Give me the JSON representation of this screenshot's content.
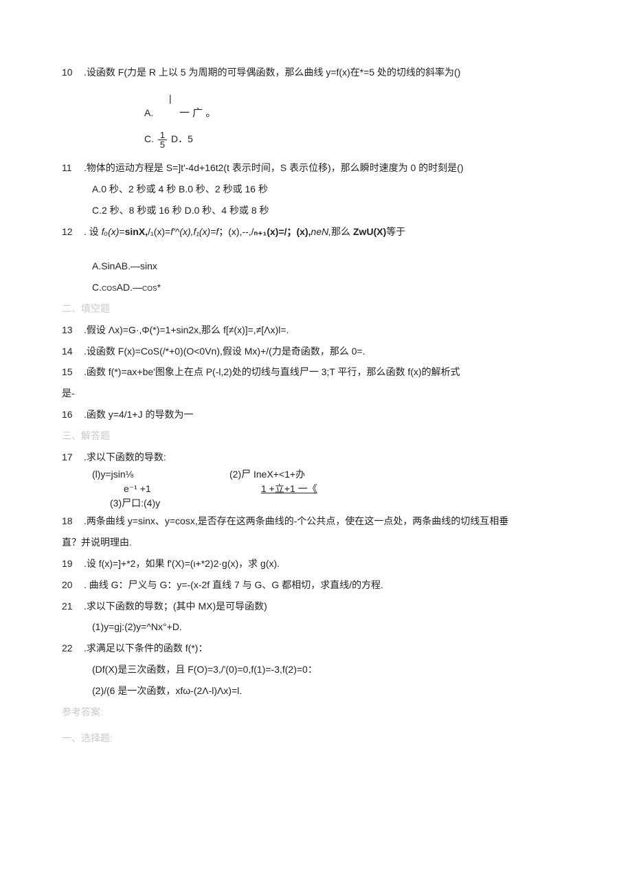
{
  "q10": {
    "num": "10",
    "text": " .设函数 F(力是 R 上以 5 为周期的可导偶函数，那么曲线 y=f(x)在*=5 处的切线的斜率为()",
    "optA_vertbar": "|",
    "optA_label": "A.",
    "optA_symbol": "一 广 。",
    "optC": "C.",
    "optC_frac_top": "1",
    "optC_frac_bot": "5",
    "optD": "D．5"
  },
  "q11": {
    "num": "11",
    "text": " .物体的运动方程是 S=]t'-4d+16t2(t 表示时间，S 表示位移)，那么瞬时速度为 0 的时刻是()",
    "optAB": "A.0 秒、2 秒或 4 秒 B.0 秒、2 秒或 16 秒",
    "optCD": "C.2 秒、8 秒或 16 秒 D.0 秒、4 秒或 8 秒"
  },
  "q12": {
    "num": "12",
    "prefix": " . 设 ",
    "expr_a": "fₒ(x)",
    "expr_eq1": "=",
    "expr_b": "sinX,",
    "expr_c": "/₁(x)",
    "expr_eq2": "=",
    "expr_d": "f'^(x),f₁(x)=f",
    "expr_e": "；(x),--,/",
    "expr_f": "ₙ₊₁",
    "expr_g": "(x)=/；(x),",
    "expr_h": "neN,",
    "expr_i": "那么 ",
    "expr_j": "Zᴡ",
    "expr_k": "U(X)",
    "expr_l": "等于",
    "optAB": "A.SinAB.—sinx",
    "optCD": "C.cosAD.—cos*"
  },
  "sec2": "二、填空题",
  "q13": {
    "num": "13",
    "text": " .假设 Λx)=G·,Φ(*)=1+sin2x,那么 f[≠(x)]=,≠[Λx)l=."
  },
  "q14": {
    "num": "14",
    "text": " .设函数 F(x)=CoS(/*+0)(O<0Vn),假设 Mx)+/(力是奇函数，那么 0=."
  },
  "q15": {
    "num": "15",
    "text": " .函数 f(*)=ax+be'图象上在点 P(-l,2)处的切线与直线尸一 3;T 平行，那么函数 f(x)的解析式",
    "cont": "是-"
  },
  "q16": {
    "num": "16",
    "text": " .函数 y=4/1+J 的导数为一"
  },
  "sec3": "三、解答题",
  "q17": {
    "num": "17",
    "text": " .求以下函数的导数:",
    "l1c1": "(l)y=jsin⅛",
    "l1c2": "(2)尸 IneX+<1+办",
    "l2c1": "e⁻¹ +1",
    "l2c2": "1 +立+1 一《",
    "l3": "(3)尸口:(4)y"
  },
  "q18": {
    "num": "18",
    "text": " .两条曲线 y=sinx、y=cosx,是否存在这两条曲线的-个公共点，使在这一点处，两条曲线的切线互相垂",
    "cont": "直？并说明理由."
  },
  "q19": {
    "num": "19",
    "text": " .设 f(x)=]+*2，如果 f'(X)=(ι+*2)2·g(x)，求 g(x)."
  },
  "q20": {
    "num": "20",
    "text": " . 曲线 G：尸义与 G：y=-(x-2f 直线 7 与 G、G 都相切，求直线/的方程."
  },
  "q21": {
    "num": "21",
    "text": " .求以下函数的导数；(其中 MX)是可导函数)",
    "sub": "(1)y=gj:(2)y=^Nx°+D."
  },
  "q22": {
    "num": "22",
    "text": " .求满足以下条件的函数 f(*)：",
    "l1": "(Df(X)是三次函数，且 F(O)=3,/'(0)=0,f(1)=-3,f(2)=0：",
    "l2": "(2)/(6 是一次函数，xfω-(2Λ-l)Λx)=l."
  },
  "answers": "参考答案:",
  "sec1answers": "一、选择题:"
}
